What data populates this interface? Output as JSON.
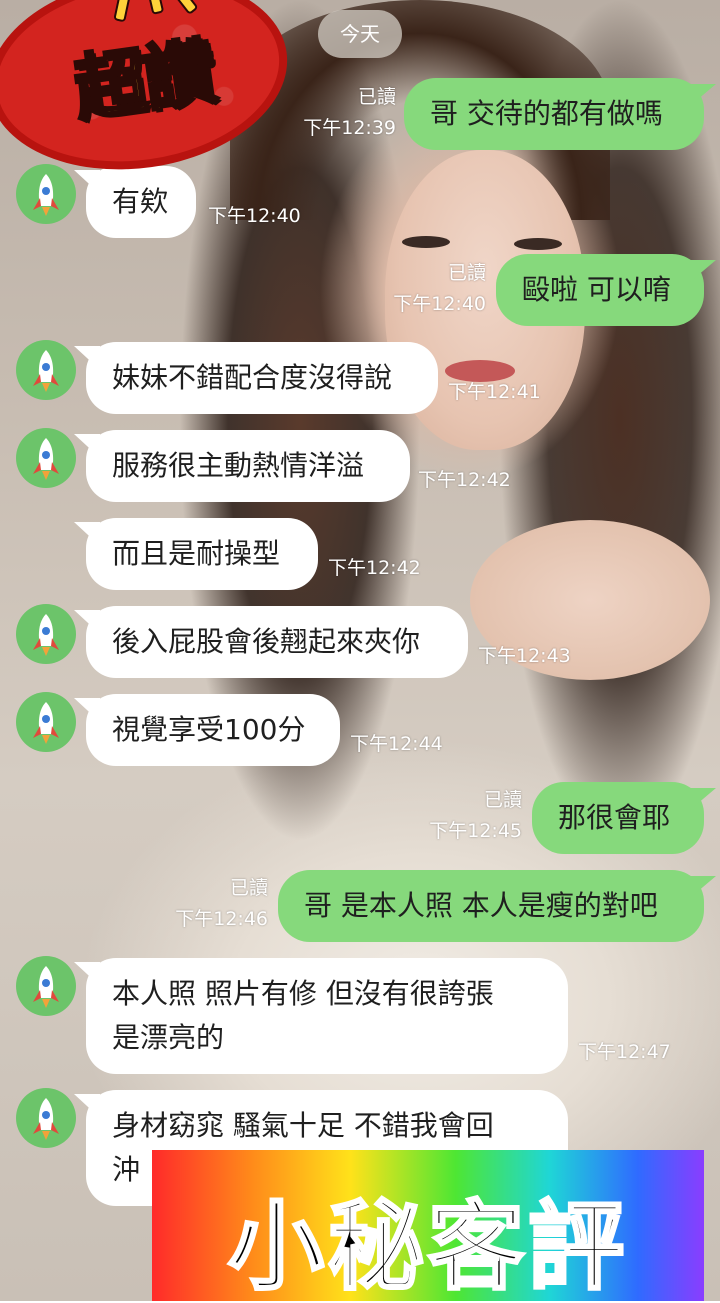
{
  "date_divider": "今天",
  "badge": {
    "text": "超讚"
  },
  "messages": [
    {
      "side": "out",
      "read": "已讀",
      "time": "下午12:39",
      "text": "哥 交待的都有做嗎"
    },
    {
      "side": "in",
      "time": "下午12:40",
      "text": "有欸"
    },
    {
      "side": "out",
      "read": "已讀",
      "time": "下午12:40",
      "text": "毆啦 可以唷"
    },
    {
      "side": "in",
      "time": "下午12:41",
      "text": "妹妹不錯配合度沒得說"
    },
    {
      "side": "in",
      "time": "下午12:42",
      "text": "服務很主動熱情洋溢"
    },
    {
      "side": "in",
      "time": "下午12:42",
      "text": "而且是耐操型"
    },
    {
      "side": "in",
      "time": "下午12:43",
      "text": "後入屁股會後翹起來夾你"
    },
    {
      "side": "in",
      "time": "下午12:44",
      "text": "視覺享受100分"
    },
    {
      "side": "out",
      "read": "已讀",
      "time": "下午12:45",
      "text": "那很會耶"
    },
    {
      "side": "out",
      "read": "已讀",
      "time": "下午12:46",
      "text": "哥 是本人照 本人是瘦的對吧"
    },
    {
      "side": "in",
      "time": "下午12:47",
      "lines": [
        "本人照 照片有修 但沒有很誇張",
        "是漂亮的"
      ]
    },
    {
      "side": "in",
      "lines": [
        "身材窈窕 騷氣十足 不錯我會回",
        "沖"
      ]
    }
  ],
  "avatar_icon": "rocket-icon",
  "banner": {
    "text": "小秘客評"
  },
  "colors": {
    "outgoing_bubble": "#86d97c",
    "incoming_bubble": "#ffffff",
    "avatar": "#6cc46a",
    "badge": "#d3241f"
  }
}
